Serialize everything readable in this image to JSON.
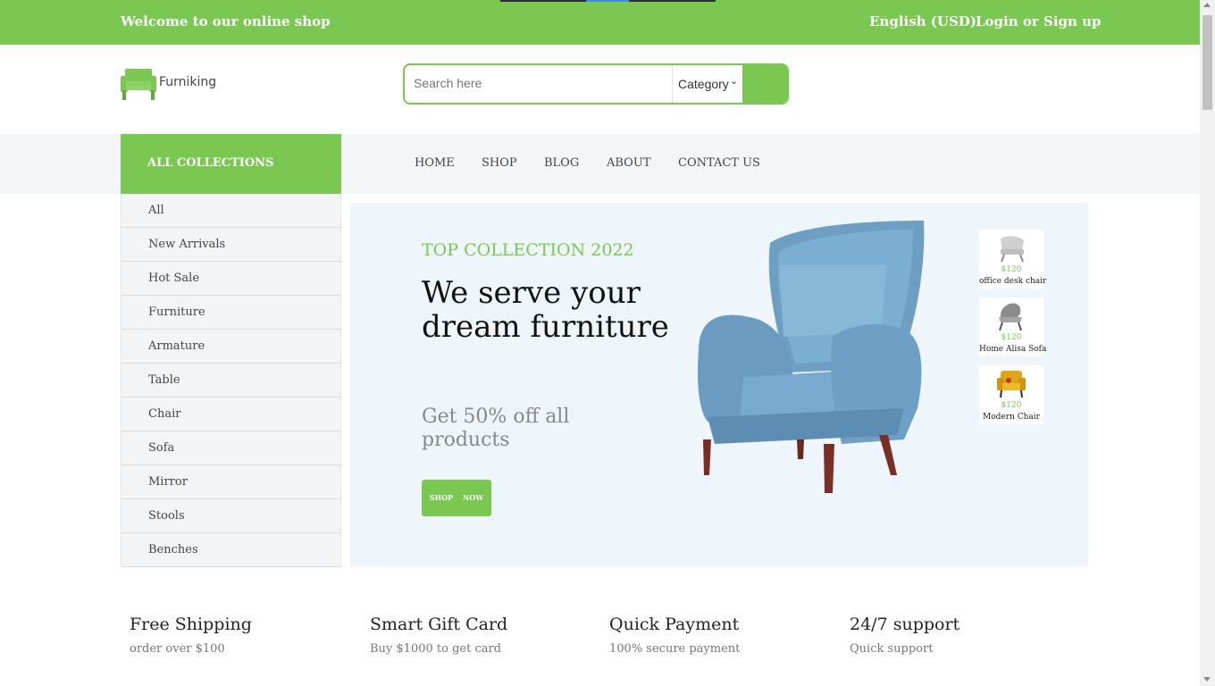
{
  "topbar": {
    "welcome": "Welcome to our online shop",
    "language": "English (USD)",
    "login": "Login or Sign up"
  },
  "brand": {
    "name": "Furniking",
    "accent_color": "#7ac851"
  },
  "search": {
    "placeholder": "Search here",
    "category_selected": "Category"
  },
  "collections": {
    "title": "ALL COLLECTIONS",
    "items": [
      "All",
      "New Arrivals",
      "Hot Sale",
      "Furniture",
      "Armature",
      "Table",
      "Chair",
      "Sofa",
      "Mirror",
      "Stools",
      "Benches"
    ]
  },
  "nav": {
    "items": [
      "HOME",
      "SHOP",
      "BLOG",
      "ABOUT",
      "CONTACT US"
    ]
  },
  "hero": {
    "eyebrow": "TOP COLLECTION 2022",
    "headline": "We serve your dream furniture",
    "subheadline": "Get 50% off all products",
    "cta": "SHOP NOW",
    "thumbnails": [
      {
        "price": "$120",
        "name": "office desk chair",
        "icon": "office-chair-icon"
      },
      {
        "price": "$120",
        "name": "Home Alisa Sofa",
        "icon": "lounge-chair-icon"
      },
      {
        "price": "$120",
        "name": "Modern Chair",
        "icon": "yellow-armchair-icon"
      }
    ]
  },
  "features": [
    {
      "title": "Free Shipping",
      "subtitle": "order over $100"
    },
    {
      "title": "Smart Gift Card",
      "subtitle": "Buy $1000 to get card"
    },
    {
      "title": "Quick Payment",
      "subtitle": "100% secure payment"
    },
    {
      "title": "24/7 support",
      "subtitle": "Quick support"
    }
  ]
}
